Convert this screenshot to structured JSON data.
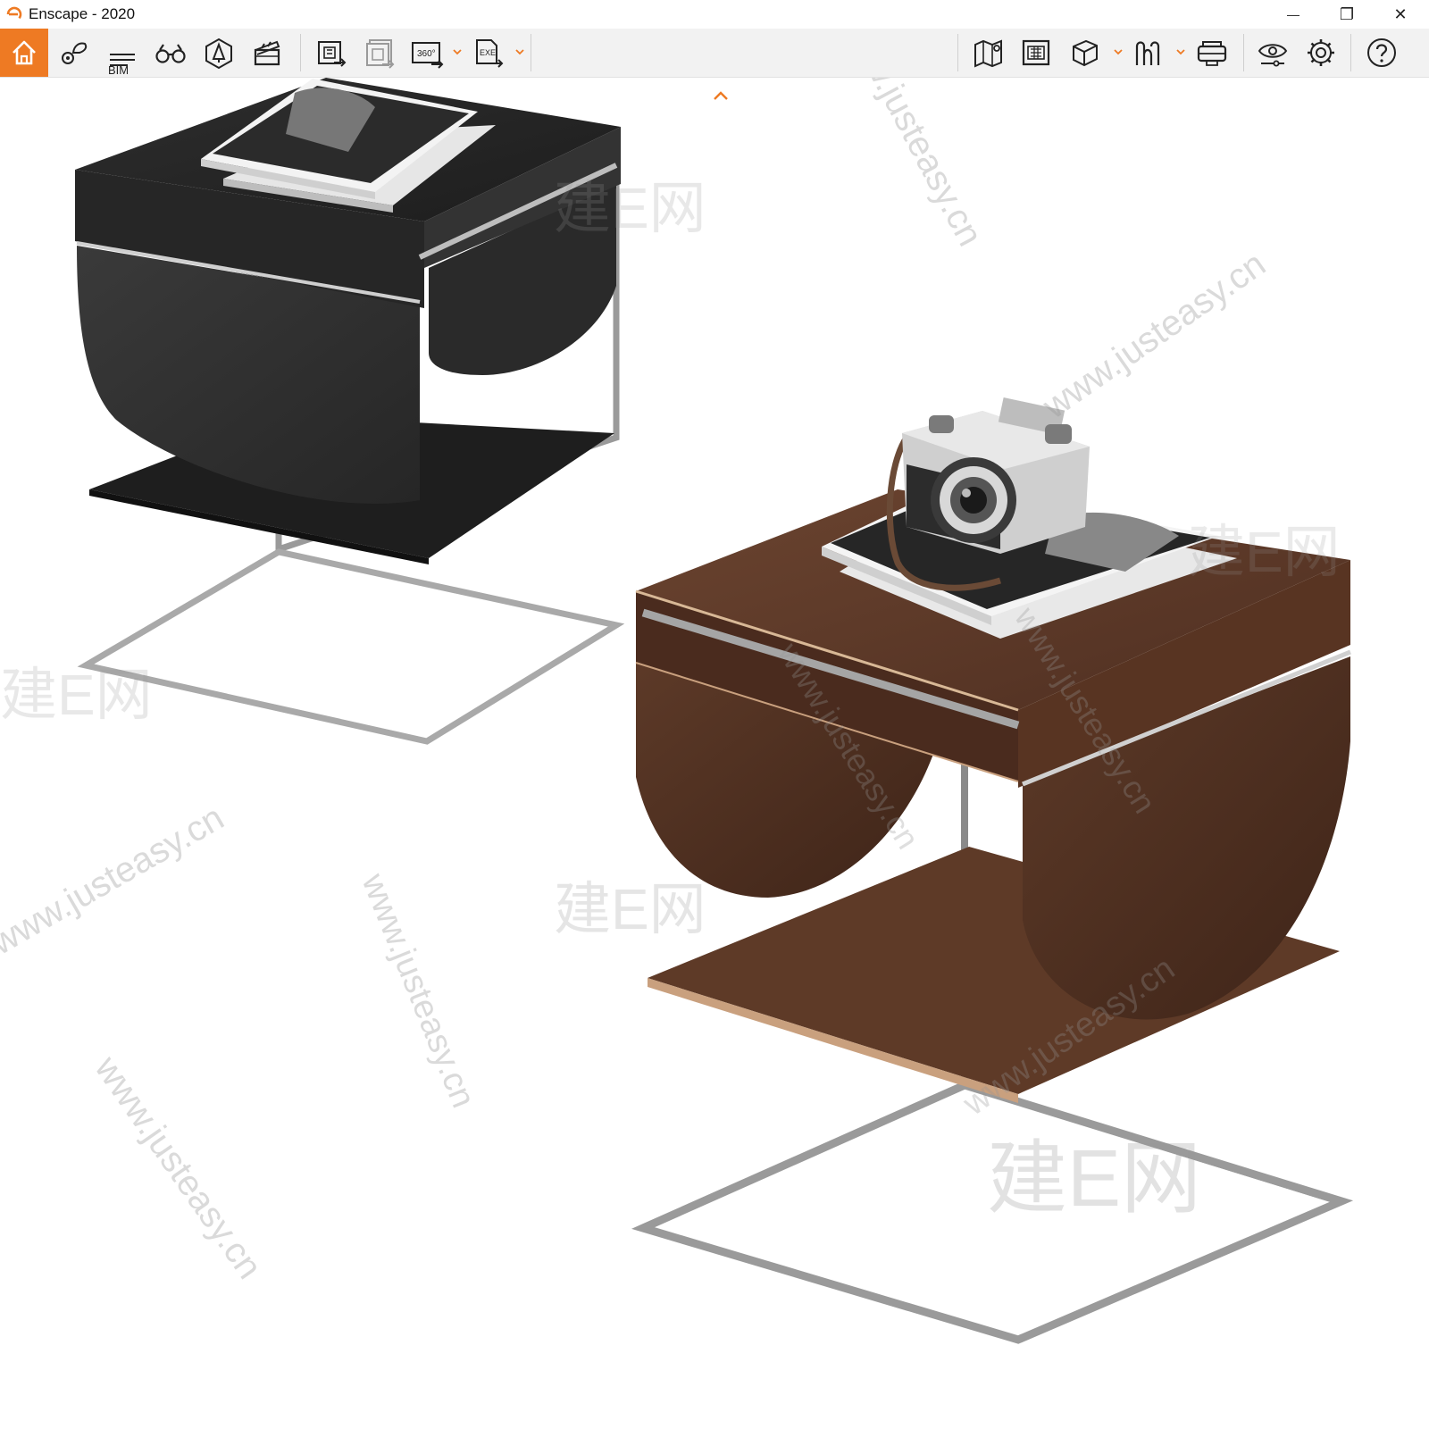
{
  "window": {
    "title": "Enscape - 2020",
    "controls": {
      "minimize": "—",
      "restore": "❐",
      "close": "✕"
    }
  },
  "toolbar": {
    "bim_label": "BIM",
    "accent_color": "#ee7a23",
    "icons": [
      "home-icon",
      "location-pin-icon",
      "bim-info-icon",
      "binoculars-icon",
      "light-asset-icon",
      "clapperboard-icon",
      "export-image-icon",
      "batch-export-icon",
      "panorama-360-icon",
      "export-exe-icon",
      "map-pin-icon",
      "building-grid-icon",
      "cube-icon",
      "material-editor-icon",
      "vr-headset-icon",
      "visual-settings-icon",
      "settings-gear-icon",
      "help-icon"
    ]
  },
  "watermarks": [
    "www.justeasy.cn",
    "建E网"
  ],
  "viewport": {
    "objects": [
      "black-wood-side-table",
      "walnut-side-table",
      "camera",
      "magazines"
    ]
  }
}
